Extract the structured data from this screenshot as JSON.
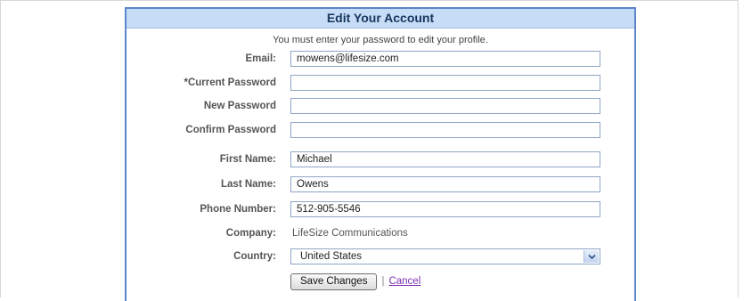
{
  "form": {
    "title": "Edit Your Account",
    "notice": "You must enter your password to edit your profile.",
    "fields": [
      {
        "label": "Email:",
        "value": "mowens@lifesize.com"
      },
      {
        "label": "*Current Password",
        "value": ""
      },
      {
        "label": "New Password",
        "value": ""
      },
      {
        "label": "Confirm Password",
        "value": ""
      },
      {
        "label": "First Name:",
        "value": "Michael"
      },
      {
        "label": "Last Name:",
        "value": "Owens"
      },
      {
        "label": "Phone Number:",
        "value": "512-905-5546"
      }
    ],
    "company": {
      "label": "Company:",
      "value": "LifeSize Communications"
    },
    "country": {
      "label": "Country:",
      "value": "United States"
    },
    "save_label": "Save Changes",
    "separator": "|",
    "cancel_label": "Cancel"
  },
  "colors": {
    "header_bg": "#c7dcf6",
    "border_accent": "#5b86c8",
    "cancel_link": "#7a2fb0"
  },
  "icons": {
    "country_dropdown": "chevron-down-icon"
  }
}
